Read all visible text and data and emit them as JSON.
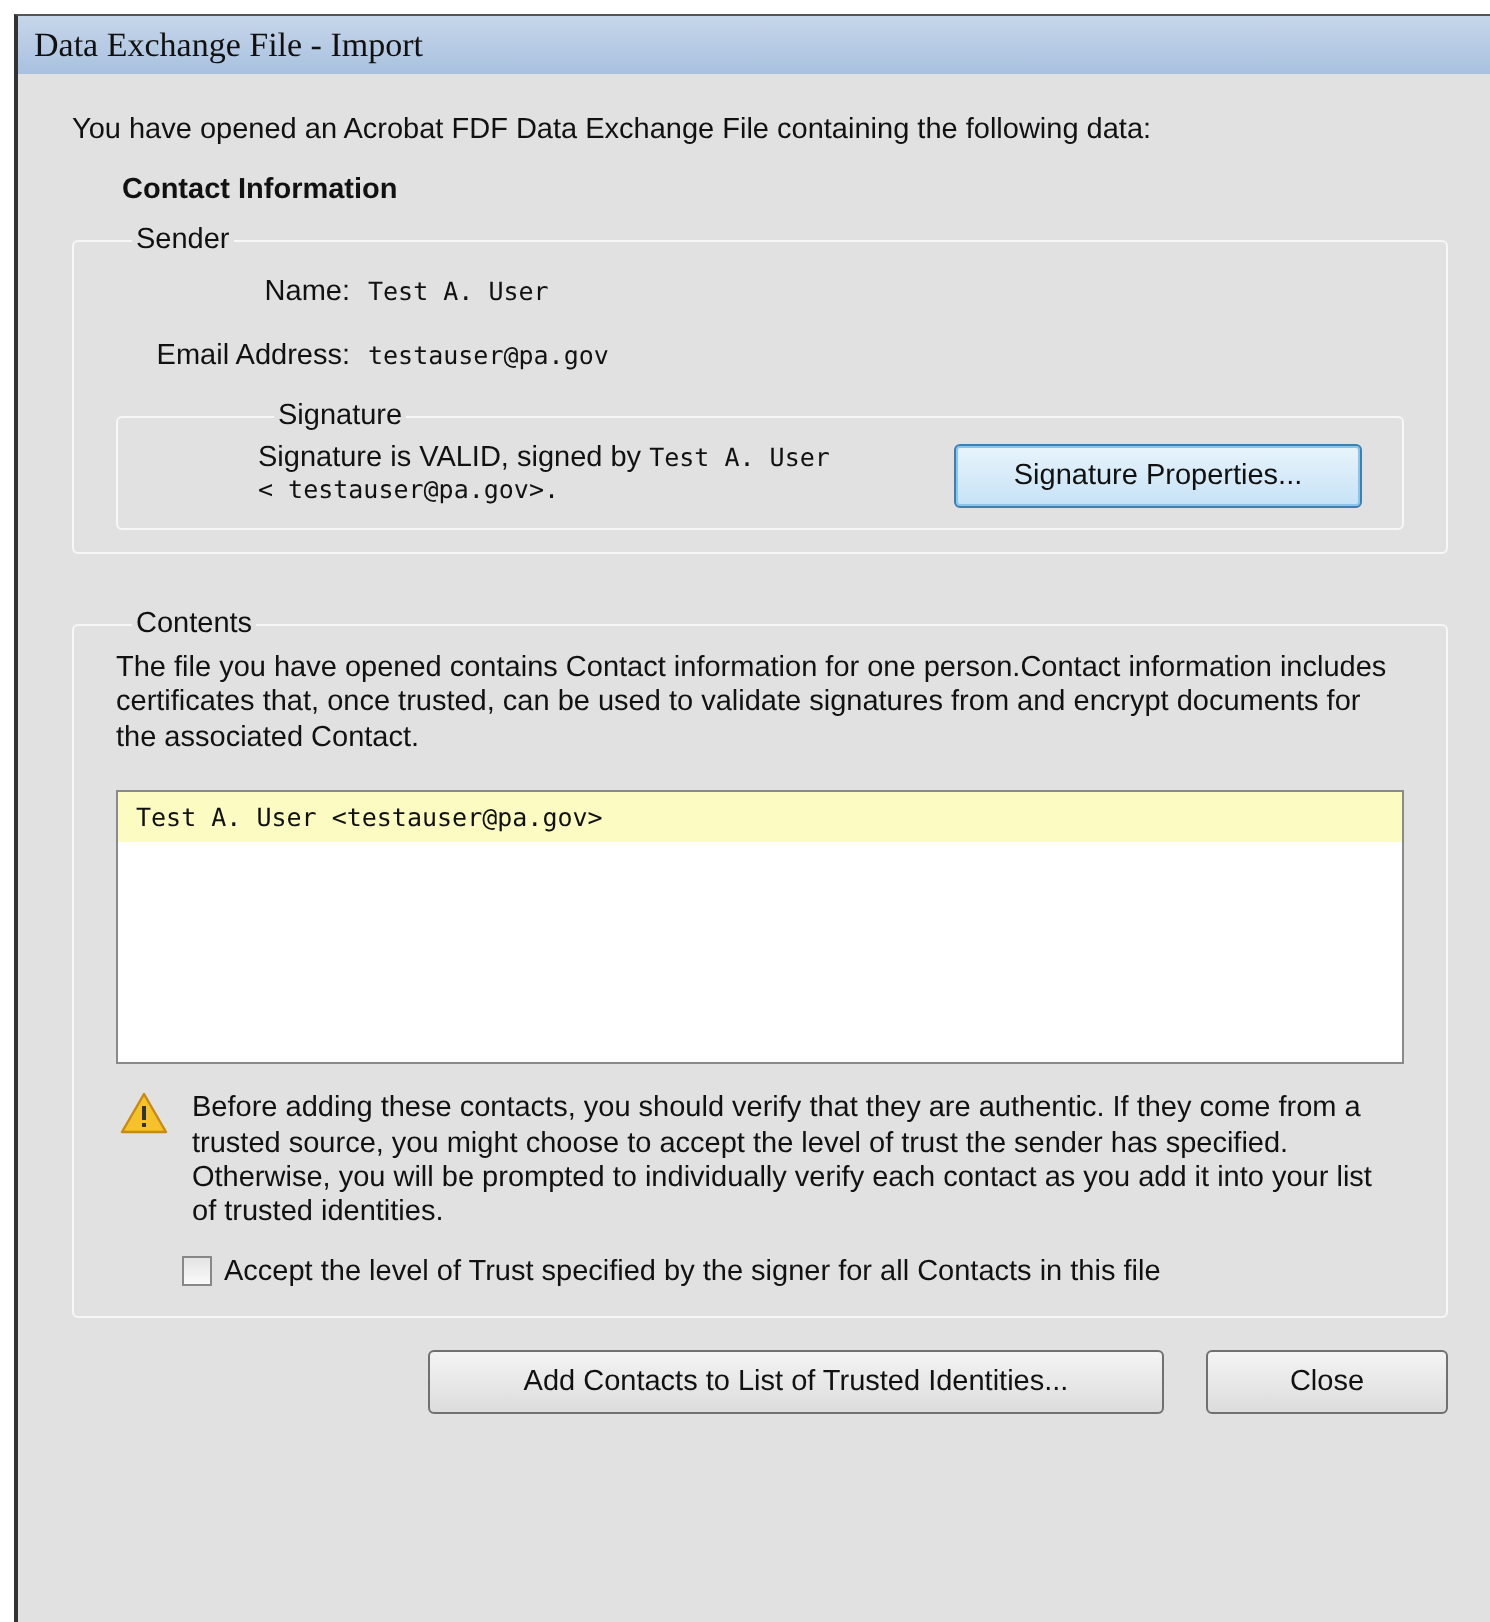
{
  "window": {
    "title": "Data Exchange File - Import"
  },
  "intro": "You have opened an Acrobat FDF Data Exchange File containing the following data:",
  "heading": "Contact Information",
  "sender": {
    "legend": "Sender",
    "name_label": "Name:",
    "name_value": "Test A. User",
    "email_label": "Email Address:",
    "email_value": "testauser@pa.gov",
    "signature": {
      "legend": "Signature",
      "status_prefix": "Signature is VALID, signed by",
      "signer": "Test A. User < testauser@pa.gov>.",
      "button": "Signature Properties..."
    }
  },
  "contents": {
    "legend": "Contents",
    "description": "The file you have opened contains Contact information for one person.Contact information includes certificates that, once trusted, can be used to validate signatures from and encrypt documents for the associated Contact.",
    "contacts": [
      {
        "label": "Test A. User <testauser@pa.gov>",
        "selected": true
      }
    ],
    "warning": "Before adding these contacts, you should verify that they are authentic. If they come from a trusted source, you might choose to accept the level of trust the sender has specified. Otherwise, you will be prompted to individually verify each contact as you add it into your list of trusted identities.",
    "accept_trust": {
      "label": "Accept the level of Trust specified by the signer for all Contacts in this file",
      "checked": false
    }
  },
  "buttons": [
    {
      "label": "Add Contacts to List of Trusted Identities...",
      "kind": "wide"
    },
    {
      "label": "Close",
      "kind": "narrow"
    }
  ]
}
